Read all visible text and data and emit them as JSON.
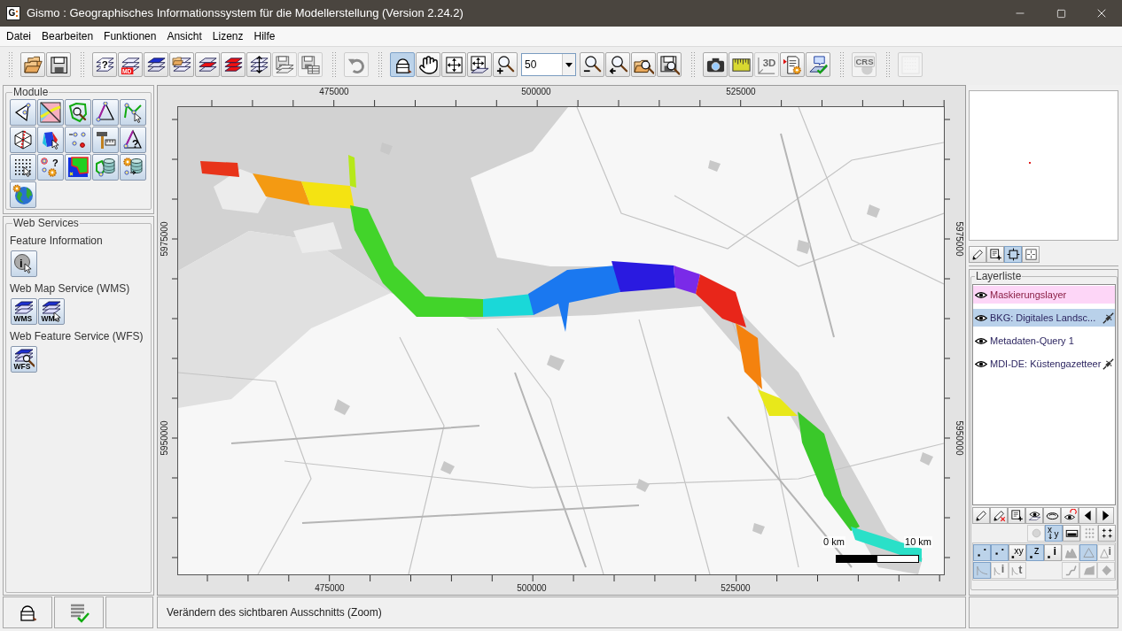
{
  "window": {
    "title": "Gismo : Geographisches Informationssystem für die Modellerstellung (Version 2.24.2)",
    "app_icon": "G"
  },
  "menu": [
    "Datei",
    "Bearbeiten",
    "Funktionen",
    "Ansicht",
    "Lizenz",
    "Hilfe"
  ],
  "toolbar": {
    "groups": [
      {
        "buttons": [
          {
            "kind": "open",
            "disabled": false
          },
          {
            "kind": "save",
            "disabled": false
          }
        ]
      },
      {
        "buttons": [
          {
            "kind": "layer-query",
            "badge": "?",
            "disabled": false
          },
          {
            "kind": "layer-meta",
            "badge": "MD",
            "disabled": false
          },
          {
            "kind": "layer-top",
            "disabled": false
          },
          {
            "kind": "layer-folder",
            "disabled": false
          },
          {
            "kind": "layer-middle",
            "disabled": false
          },
          {
            "kind": "layer-filled",
            "disabled": false
          },
          {
            "kind": "layer-arrows",
            "disabled": false
          },
          {
            "kind": "floppy-layers",
            "disabled": true
          },
          {
            "kind": "floppy-grid",
            "disabled": true
          }
        ]
      },
      {
        "buttons": [
          {
            "kind": "undo",
            "disabled": true
          }
        ]
      },
      {
        "buttons": [
          {
            "kind": "bucket",
            "disabled": false,
            "pressed": true
          },
          {
            "kind": "hand",
            "disabled": false,
            "pressed": false
          },
          {
            "kind": "expand",
            "disabled": false,
            "pressed": false
          },
          {
            "kind": "expand-layer",
            "disabled": false,
            "pressed": false
          },
          {
            "kind": "zoom-in",
            "disabled": false,
            "pressed": false
          }
        ],
        "zoom_field": {
          "value": "50"
        },
        "buttons_after": [
          {
            "kind": "zoom-out",
            "disabled": false,
            "pressed": false
          },
          {
            "kind": "zoom-back",
            "disabled": false,
            "pressed": false
          },
          {
            "kind": "folder-search",
            "disabled": false,
            "pressed": false
          },
          {
            "kind": "floppy-search",
            "disabled": false,
            "pressed": false
          }
        ]
      },
      {
        "buttons": [
          {
            "kind": "camera",
            "disabled": false
          },
          {
            "kind": "ruler",
            "disabled": false
          },
          {
            "kind": "axes-3d",
            "badge": "3D",
            "disabled": true
          },
          {
            "kind": "doc-gear",
            "disabled": false
          },
          {
            "kind": "sheet-check",
            "disabled": false
          }
        ]
      },
      {
        "buttons": [
          {
            "kind": "crs",
            "badge": "CRS",
            "disabled": true
          }
        ]
      },
      {
        "buttons": [
          {
            "kind": "blank",
            "disabled": true
          }
        ]
      }
    ]
  },
  "modules": {
    "title": "Module",
    "buttons": [
      {
        "kind": "m-tri-points"
      },
      {
        "kind": "m-road-map"
      },
      {
        "kind": "m-polygon-search"
      },
      {
        "kind": "m-tri-nodes"
      },
      {
        "kind": "m-polyline"
      },
      {
        "kind": "m-mesh-cut"
      },
      {
        "kind": "m-prism"
      },
      {
        "kind": "m-points"
      },
      {
        "kind": "m-hammer"
      },
      {
        "kind": "m-tri-question",
        "badge": "?"
      },
      {
        "kind": "m-grid-cursor"
      },
      {
        "kind": "m-points-gear",
        "badge": "?"
      },
      {
        "kind": "m-raster"
      },
      {
        "kind": "m-polygon-db"
      },
      {
        "kind": "m-gear-db"
      },
      {
        "kind": "m-globe"
      }
    ]
  },
  "web_services": {
    "title": "Web Services",
    "sections": [
      {
        "label": "Feature Information",
        "buttons": [
          {
            "kind": "info-cursor",
            "badge": "i"
          }
        ]
      },
      {
        "label": "Web Map Service (WMS)",
        "buttons": [
          {
            "kind": "wms",
            "badge": "WMS"
          },
          {
            "kind": "wms-cursor",
            "badge": "WMS"
          }
        ]
      },
      {
        "label": "Web Feature Service (WFS)",
        "buttons": [
          {
            "kind": "wfs-search",
            "badge": "WFS"
          }
        ]
      }
    ]
  },
  "map": {
    "top_axis": [
      "475000",
      "500000",
      "525000"
    ],
    "bottom_axis": [
      "475000",
      "500000",
      "525000"
    ],
    "left_axis": [
      "5975000",
      "5950000"
    ],
    "right_axis": [
      "5975000",
      "5950000"
    ],
    "scale_bar": {
      "start_label": "0 km",
      "end_label": "10 km"
    }
  },
  "view_tools": [
    {
      "kind": "pencil",
      "pressed": false
    },
    {
      "kind": "doc-add",
      "pressed": false
    },
    {
      "kind": "frame",
      "pressed": true
    },
    {
      "kind": "frame-center",
      "pressed": false
    }
  ],
  "layer_list": {
    "title": "Layerliste",
    "layers": [
      {
        "name": "Maskierungslayer",
        "visible": true,
        "highlighted": true,
        "selected": false,
        "linked": false
      },
      {
        "name": "BKG: Digitales Landsc...",
        "visible": true,
        "highlighted": false,
        "selected": true,
        "linked": true
      },
      {
        "name": "Metadaten-Query 1",
        "visible": true,
        "highlighted": false,
        "selected": false,
        "linked": false
      },
      {
        "name": "MDI-DE: Küstengazetteer",
        "visible": true,
        "highlighted": false,
        "selected": false,
        "linked": true
      }
    ]
  },
  "layer_tools": {
    "row_1": [
      {
        "kind": "pencil",
        "disabled": false,
        "pressed": false
      },
      {
        "kind": "pencil-x",
        "disabled": false,
        "pressed": false
      },
      {
        "kind": "doc-add",
        "disabled": false,
        "pressed": false
      },
      {
        "kind": "eye-layers",
        "disabled": false,
        "pressed": false
      },
      {
        "kind": "eye-ring",
        "disabled": false,
        "pressed": false
      },
      {
        "kind": "eye-refresh",
        "disabled": false,
        "pressed": false
      },
      {
        "kind": "tri-left",
        "disabled": false,
        "pressed": false
      },
      {
        "kind": "tri-right",
        "disabled": false,
        "pressed": false
      }
    ],
    "row_2": [
      {
        "kind": "circle",
        "disabled": true,
        "pressed": false
      },
      {
        "kind": "xy-arrow",
        "badge": "x y",
        "disabled": false,
        "pressed": true
      },
      {
        "kind": "bar",
        "disabled": false,
        "pressed": false
      },
      {
        "kind": "plus-grid",
        "disabled": true,
        "pressed": false
      },
      {
        "kind": "four-plus",
        "disabled": false,
        "pressed": false
      }
    ],
    "point_tools": [
      {
        "kind": "pt",
        "disabled": false,
        "pressed": true
      },
      {
        "kind": "pt-alt",
        "disabled": false,
        "pressed": true
      },
      {
        "kind": "pt-xy",
        "badge": "xy",
        "disabled": false,
        "pressed": false
      },
      {
        "kind": "pt-z",
        "badge": "z",
        "disabled": false,
        "pressed": true
      },
      {
        "kind": "pt-i",
        "badge": "i",
        "disabled": false,
        "pressed": false
      },
      {
        "kind": "terrain",
        "disabled": true,
        "pressed": false
      },
      {
        "kind": "tri",
        "disabled": true,
        "pressed": true
      },
      {
        "kind": "tri-i",
        "badge": "i",
        "disabled": true,
        "pressed": false
      }
    ],
    "line_tools_left": [
      {
        "kind": "curve",
        "disabled": true,
        "pressed": true
      },
      {
        "kind": "curve-i",
        "badge": "i",
        "disabled": true,
        "pressed": false
      },
      {
        "kind": "curve-t",
        "badge": "t",
        "disabled": true,
        "pressed": false
      }
    ],
    "line_tools_right": [
      {
        "kind": "step",
        "disabled": true,
        "pressed": false
      },
      {
        "kind": "shape",
        "disabled": true,
        "pressed": false
      },
      {
        "kind": "diamond",
        "disabled": true,
        "pressed": false
      }
    ]
  },
  "status_bar": {
    "tools": [
      {
        "kind": "bucket"
      },
      {
        "kind": "list-check"
      }
    ],
    "message": "Verändern des sichtbaren Ausschnitts (Zoom)"
  }
}
